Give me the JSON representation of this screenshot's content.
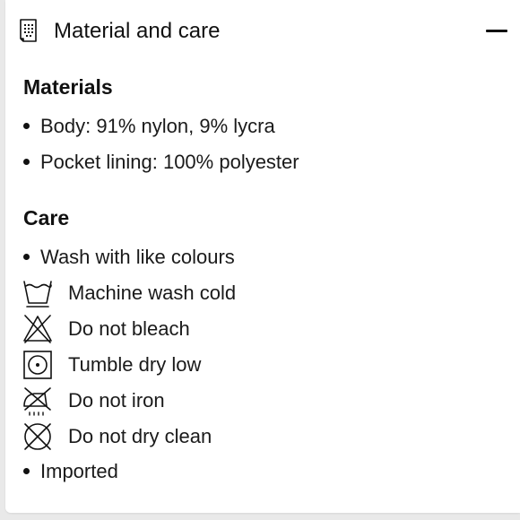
{
  "header": {
    "title": "Material and care",
    "icon": "document-icon",
    "toggle_icon": "minus-icon"
  },
  "materials": {
    "heading": "Materials",
    "items": [
      "Body: 91% nylon, 9% lycra",
      "Pocket lining: 100% polyester"
    ]
  },
  "care": {
    "heading": "Care",
    "bullet_first": "Wash with like colours",
    "symbols": [
      {
        "icon": "machine-wash-cold-icon",
        "label": "Machine wash cold"
      },
      {
        "icon": "do-not-bleach-icon",
        "label": "Do not bleach"
      },
      {
        "icon": "tumble-dry-low-icon",
        "label": "Tumble dry low"
      },
      {
        "icon": "do-not-iron-icon",
        "label": "Do not iron"
      },
      {
        "icon": "do-not-dry-clean-icon",
        "label": "Do not dry clean"
      }
    ],
    "bullet_last": "Imported"
  }
}
